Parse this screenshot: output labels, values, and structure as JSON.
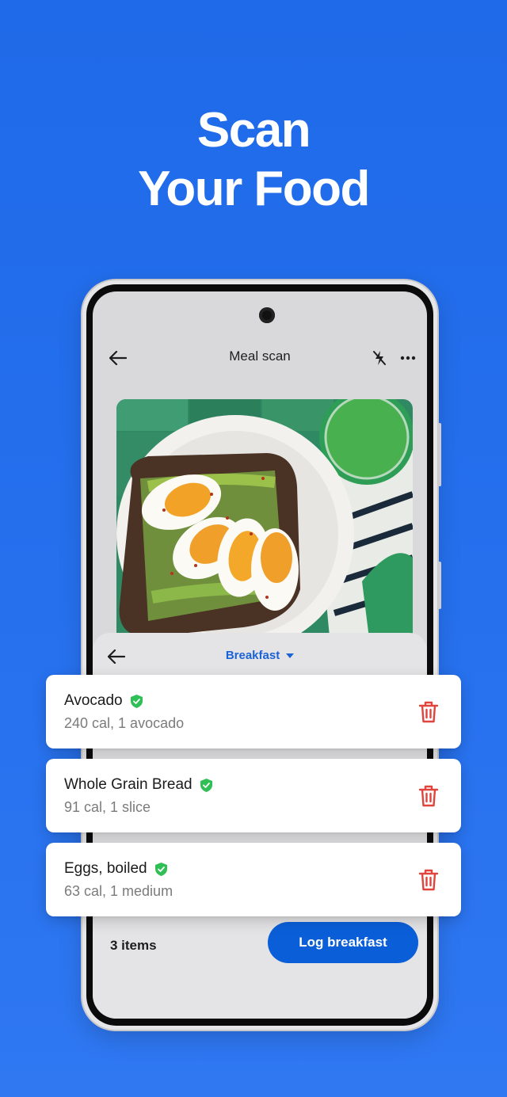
{
  "headline": {
    "line1": "Scan",
    "line2": "Your Food"
  },
  "screen": {
    "title": "Meal scan",
    "meal_selector": "Breakfast",
    "footer": {
      "count": "3 items",
      "log_button": "Log breakfast"
    }
  },
  "items": [
    {
      "name": "Avocado",
      "detail": "240 cal, 1 avocado",
      "verified": true
    },
    {
      "name": "Whole Grain Bread",
      "detail": "91 cal, 1 slice",
      "verified": true
    },
    {
      "name": "Eggs, boiled",
      "detail": "63 cal, 1 medium",
      "verified": true
    }
  ],
  "colors": {
    "background": "#2670ee",
    "primary": "#0a5fd9",
    "verified": "#2fbf55",
    "delete": "#e0443c"
  }
}
